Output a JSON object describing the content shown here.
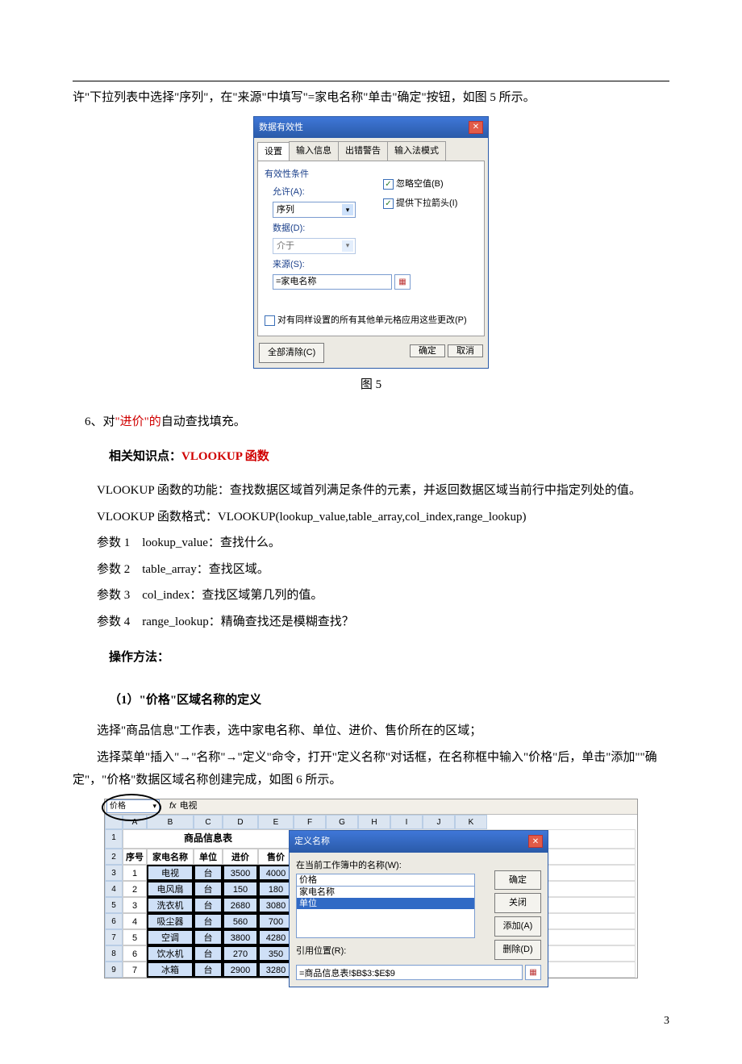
{
  "top_line": "许\"下拉列表中选择\"序列\"，在\"来源\"中填写\"=家电名称\"单击\"确定\"按钮，如图 5 所示。",
  "dlg1": {
    "title": "数据有效性",
    "tabs": [
      "设置",
      "输入信息",
      "出错警告",
      "输入法模式"
    ],
    "group": "有效性条件",
    "allow_label": "允许(A):",
    "allow_value": "序列",
    "data_label": "数据(D):",
    "data_value": "介于",
    "source_label": "来源(S):",
    "source_value": "=家电名称",
    "chk1": "忽略空值(B)",
    "chk2": "提供下拉箭头(I)",
    "apply_all": "对有同样设置的所有其他单元格应用这些更改(P)",
    "btn_clear": "全部清除(C)",
    "btn_ok": "确定",
    "btn_cancel": "取消"
  },
  "fig5_caption": "图 5",
  "step6": {
    "prefix": "6、对",
    "highlight": "\"进价\"的",
    "suffix": "自动查找填充。"
  },
  "kp_label": "相关知识点：",
  "kp_value": "VLOOKUP 函数",
  "vlookup_desc": "VLOOKUP 函数的功能：查找数据区域首列满足条件的元素，并返回数据区域当前行中指定列处的值。",
  "vlookup_format": "VLOOKUP 函数格式：VLOOKUP(lookup_value,table_array,col_index,range_lookup)",
  "params": [
    "参数 1　lookup_value：查找什么。",
    "参数 2　table_array：查找区域。",
    "参数 3　col_index：查找区域第几列的值。",
    "参数 4　range_lookup：精确查找还是模糊查找？"
  ],
  "op_label": "操作方法：",
  "sec1_title": "（1）\"价格\"区域名称的定义",
  "sec1_p1": "选择\"商品信息\"工作表，选中家电名称、单位、进价、售价所在的区域；",
  "sec1_p2": "选择菜单\"插入\"→\"名称\"→\"定义\"命令，打开\"定义名称\"对话框，在名称框中输入\"价格\"后，单击\"添加\"\"确定\"，\"价格\"数据区域名称创建完成，如图 6 所示。",
  "fig2": {
    "namebox": "价格",
    "fx": "电视",
    "cols": [
      "A",
      "B",
      "C",
      "D",
      "E",
      "F",
      "G",
      "H",
      "I",
      "J",
      "K"
    ],
    "title": "商品信息表",
    "headers": [
      "序号",
      "家电名称",
      "单位",
      "进价",
      "售价"
    ],
    "rows": [
      [
        "1",
        "电视",
        "台",
        "3500",
        "4000"
      ],
      [
        "2",
        "电风扇",
        "台",
        "150",
        "180"
      ],
      [
        "3",
        "洗衣机",
        "台",
        "2680",
        "3080"
      ],
      [
        "4",
        "吸尘器",
        "台",
        "560",
        "700"
      ],
      [
        "5",
        "空调",
        "台",
        "3800",
        "4280"
      ],
      [
        "6",
        "饮水机",
        "台",
        "270",
        "350"
      ],
      [
        "7",
        "冰箱",
        "台",
        "2900",
        "3280"
      ]
    ]
  },
  "dlg2": {
    "title": "定义名称",
    "names_in_wb": "在当前工作簿中的名称(W):",
    "input_value": "价格",
    "list": [
      "家电名称",
      "单位"
    ],
    "btn_ok": "确定",
    "btn_close": "关闭",
    "btn_add": "添加(A)",
    "btn_del": "删除(D)",
    "ref_label": "引用位置(R):",
    "ref_value": "=商品信息表!$B$3:$E$9"
  },
  "page_num": "3"
}
